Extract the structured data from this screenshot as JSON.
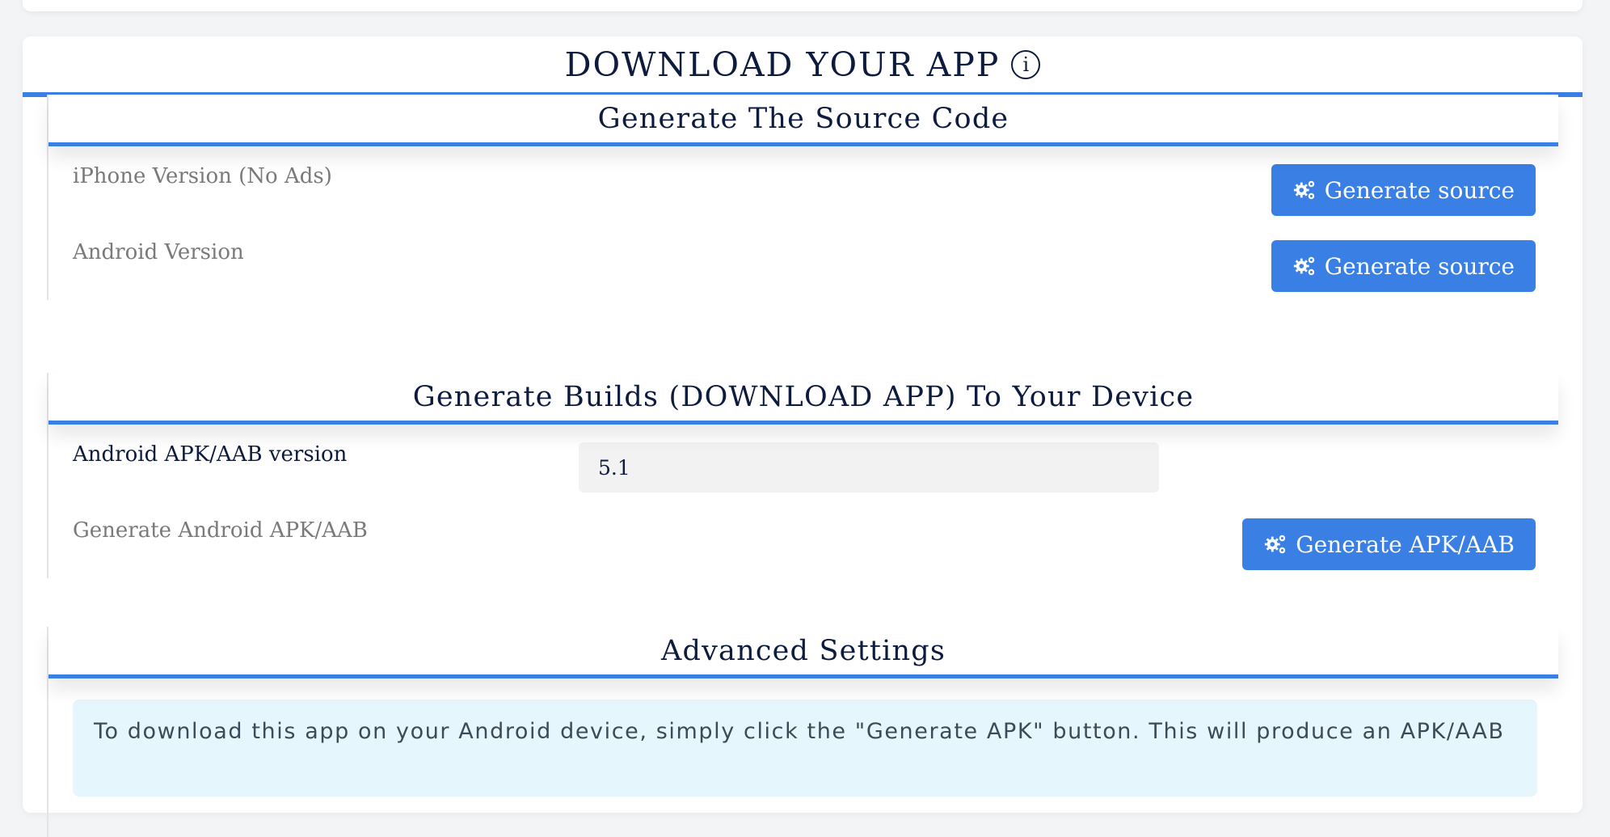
{
  "header": {
    "title": "DOWNLOAD YOUR APP",
    "info_icon": "info-circle-icon"
  },
  "source_section": {
    "title": "Generate The Source Code",
    "rows": [
      {
        "label": "iPhone Version (No Ads)",
        "button": "Generate source",
        "icon": "gears-icon"
      },
      {
        "label": "Android Version",
        "button": "Generate source",
        "icon": "gears-icon"
      }
    ]
  },
  "builds_section": {
    "title": "Generate Builds (DOWNLOAD APP) To Your Device",
    "version_label": "Android APK/AAB version",
    "version_value": "5.1",
    "generate_label": "Generate Android APK/AAB",
    "generate_button": "Generate APK/AAB"
  },
  "advanced_section": {
    "title": "Advanced Settings",
    "info_text": "To download this app on your Android device, simply click the \"Generate APK\" button. This will produce an APK/AAB"
  },
  "colors": {
    "accent": "#3a7fe4",
    "heading": "#0d1b3e",
    "info_bg": "#e6f6fd"
  }
}
